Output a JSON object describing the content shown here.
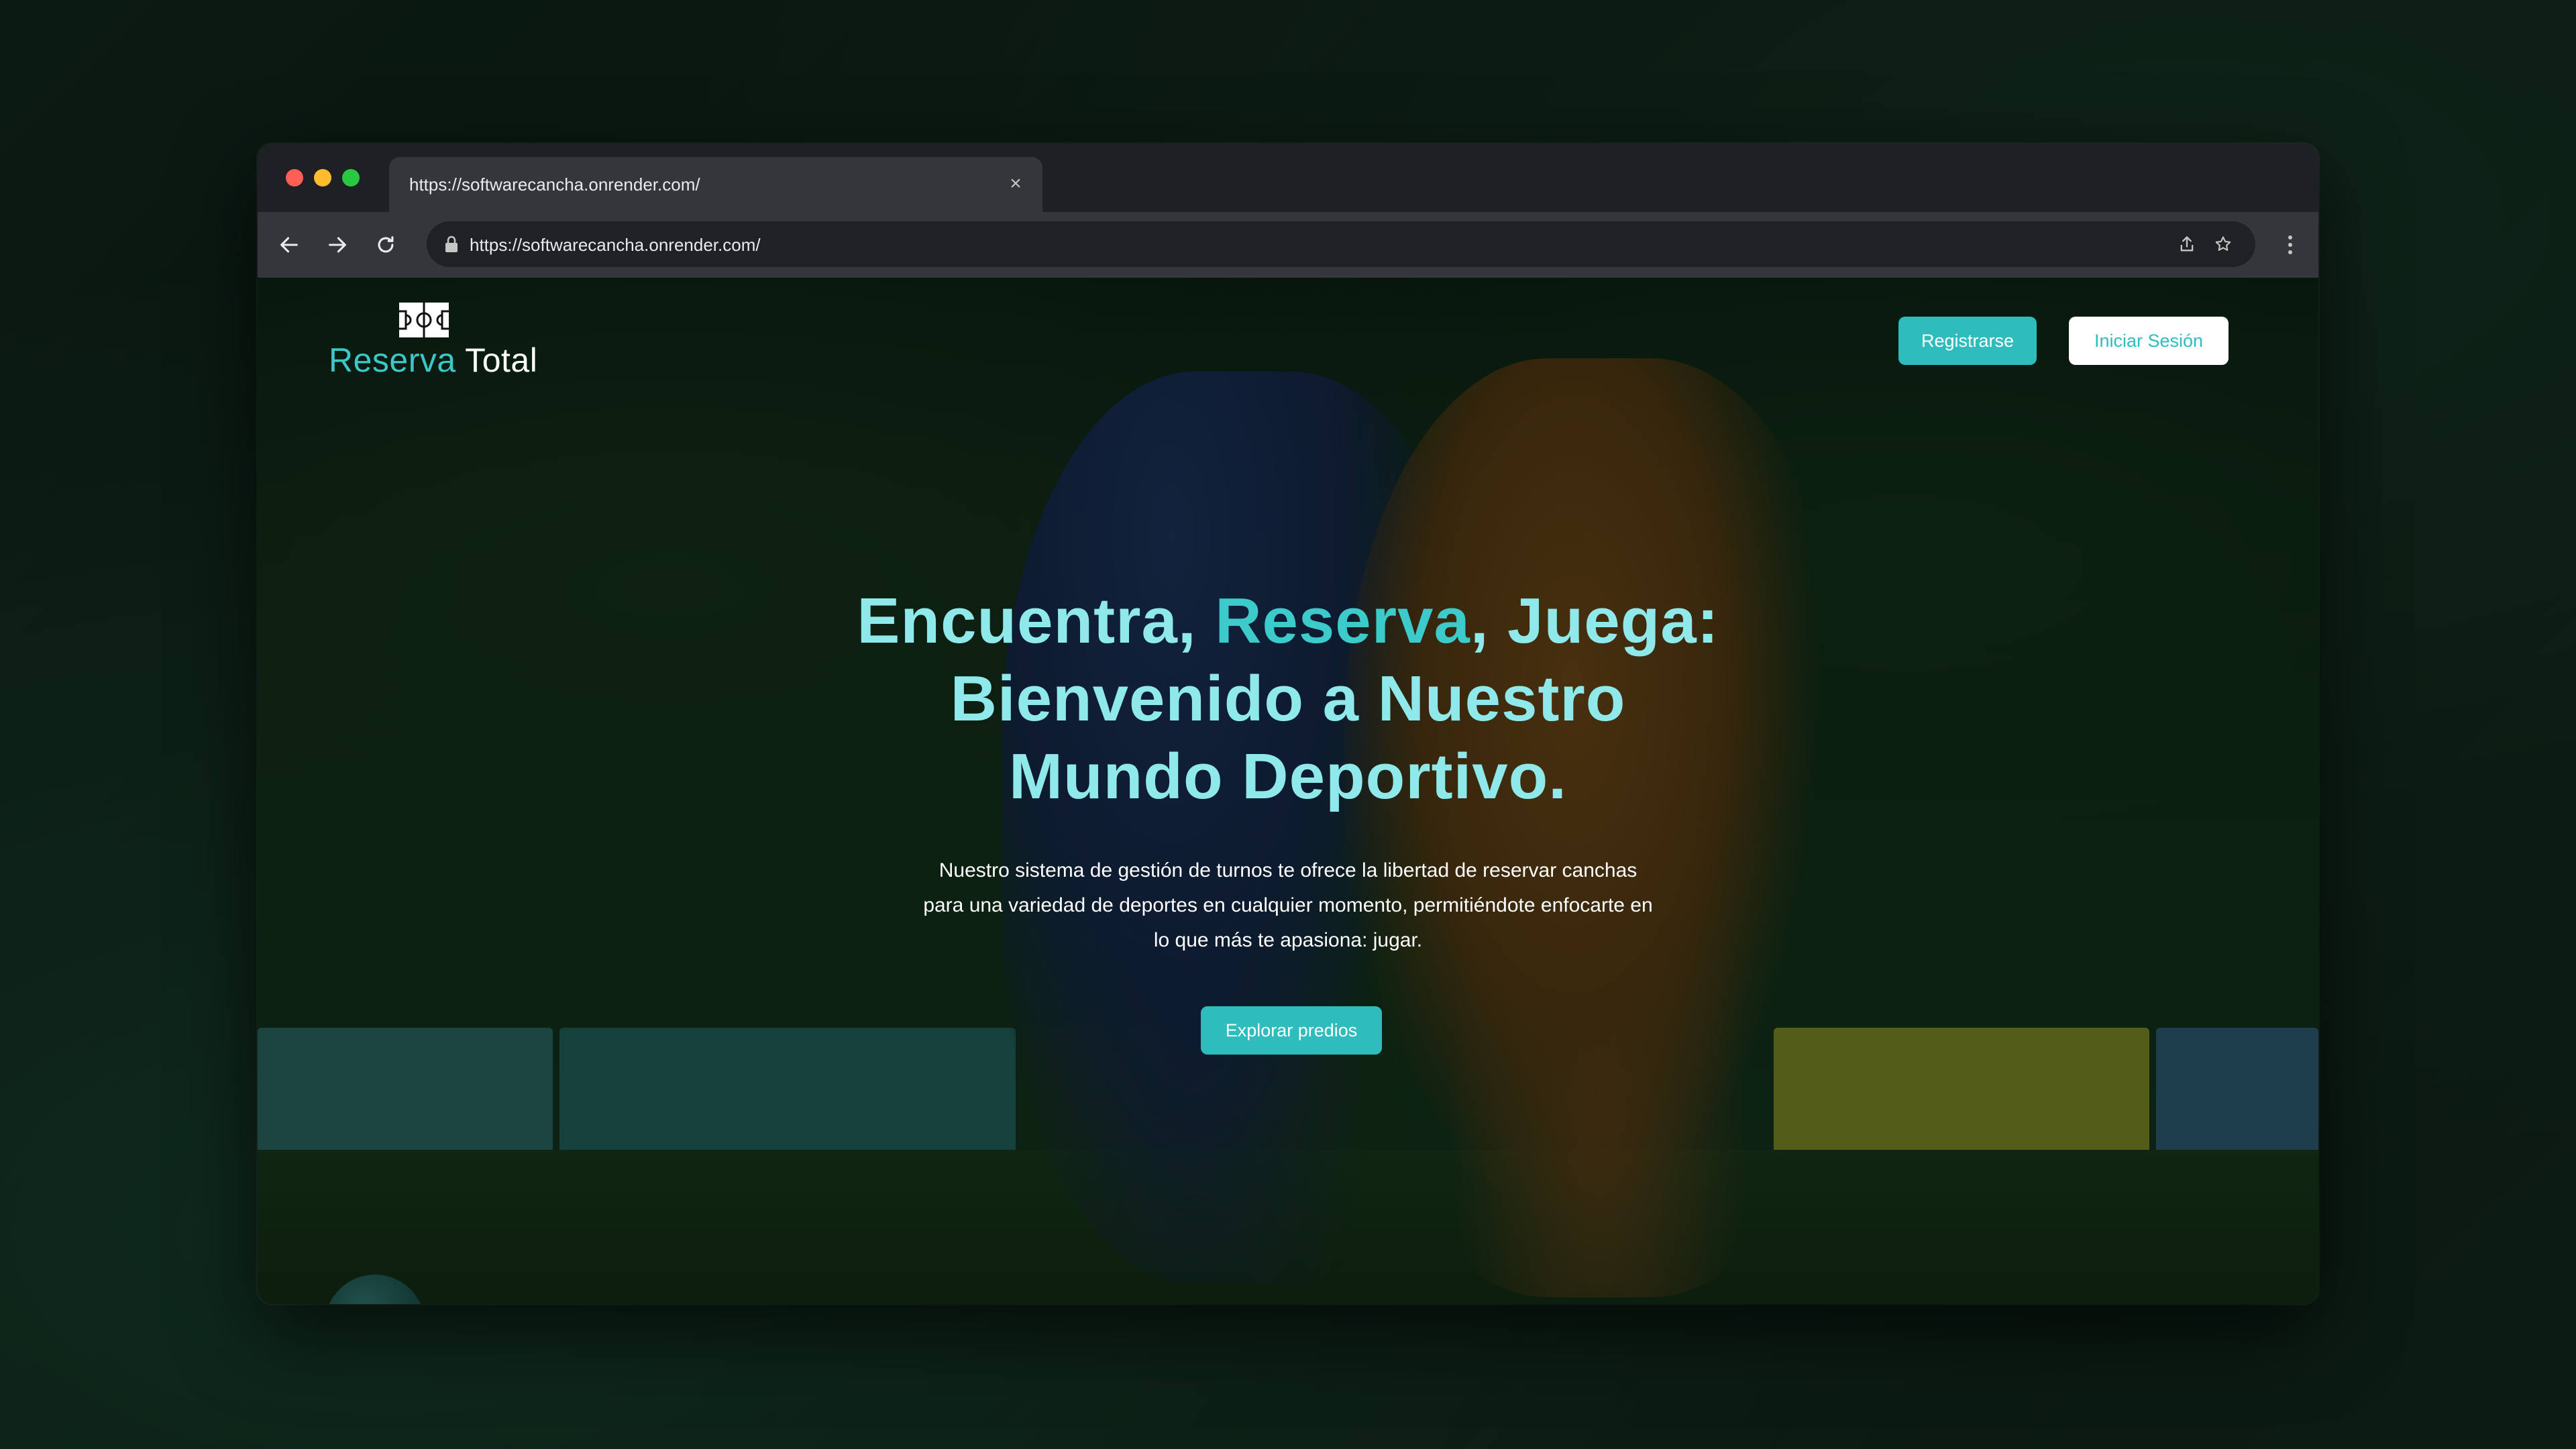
{
  "browser": {
    "tab_title": "https://softwarecancha.onrender.com/",
    "tab_close_glyph": "×",
    "url": "https://softwarecancha.onrender.com/",
    "icons": {
      "back": "arrow-left-icon",
      "forward": "arrow-right-icon",
      "reload": "reload-icon",
      "lock": "lock-icon",
      "share": "share-icon",
      "bookmark": "star-icon",
      "menu": "kebab-menu-icon",
      "tab_close": "close-icon"
    },
    "traffic_lights": [
      "#ff5f57",
      "#febc2e",
      "#28c840"
    ]
  },
  "site": {
    "logo": {
      "word1": "Reserva",
      "word2": "Total",
      "icon": "soccer-field-icon"
    },
    "nav": {
      "register_label": "Registrarse",
      "login_label": "Iniciar Sesión"
    },
    "hero": {
      "headline_part1": "Encuentra,",
      "headline_accent": "Reserva",
      "headline_part2": ", Juega:",
      "headline_line2": "Bienvenido a Nuestro",
      "headline_line3": "Mundo Deportivo.",
      "description": "Nuestro sistema de gestión de turnos te ofrece la libertad de reservar canchas para una variedad de deportes en cualquier momento, permitiéndote enfocarte en lo que más te apasiona: jugar.",
      "cta_label": "Explorar predios"
    },
    "colors": {
      "accent": "#2fbcbd",
      "headline_light": "#8fe9ea",
      "headline_accent": "#3ccaca"
    }
  }
}
